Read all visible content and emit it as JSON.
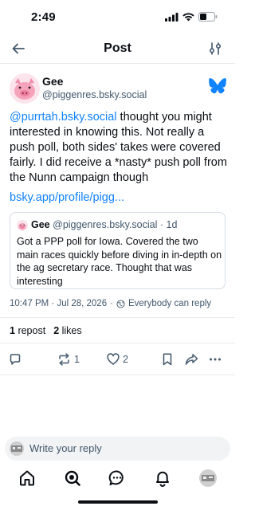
{
  "status_bar": {
    "time": "2:49"
  },
  "header": {
    "title": "Post"
  },
  "post": {
    "author_name": "Gee",
    "author_handle": "@piggenres.bsky.social",
    "mention": "@purrtah.bsky.social",
    "text": " thought you might interested in knowing this. Not really a push poll, both sides' takes were covered fairly. I did receive a *nasty* push poll from the Nunn campaign though",
    "link": "bsky.app/profile/pigg..."
  },
  "quote": {
    "author_name": "Gee",
    "author_handle": "@piggenres.bsky.social",
    "age": "1d",
    "text": "Got a PPP poll for Iowa. Covered the two main races quickly before diving in in-depth on the ag secretary race. Thought that was interesting"
  },
  "meta": {
    "timestamp": "10:47 PM · Jul 28, 2026",
    "reply_setting": "Everybody can reply"
  },
  "stats": {
    "reposts_count": "1",
    "reposts_label": "repost",
    "likes_count": "2",
    "likes_label": "likes"
  },
  "actions": {
    "repost_count": "1",
    "like_count": "2"
  },
  "reply_bar": {
    "placeholder": "Write your reply"
  },
  "colors": {
    "accent": "#1083fe",
    "text": "#0b0f14",
    "muted": "#42576c",
    "border": "#e6e9ed"
  },
  "icons": [
    "back-arrow-icon",
    "filter-icon",
    "bluesky-butterfly-icon",
    "reply-icon",
    "repost-icon",
    "heart-icon",
    "bookmark-icon",
    "share-icon",
    "more-icon",
    "home-icon",
    "search-icon",
    "chat-icon",
    "bell-icon"
  ]
}
